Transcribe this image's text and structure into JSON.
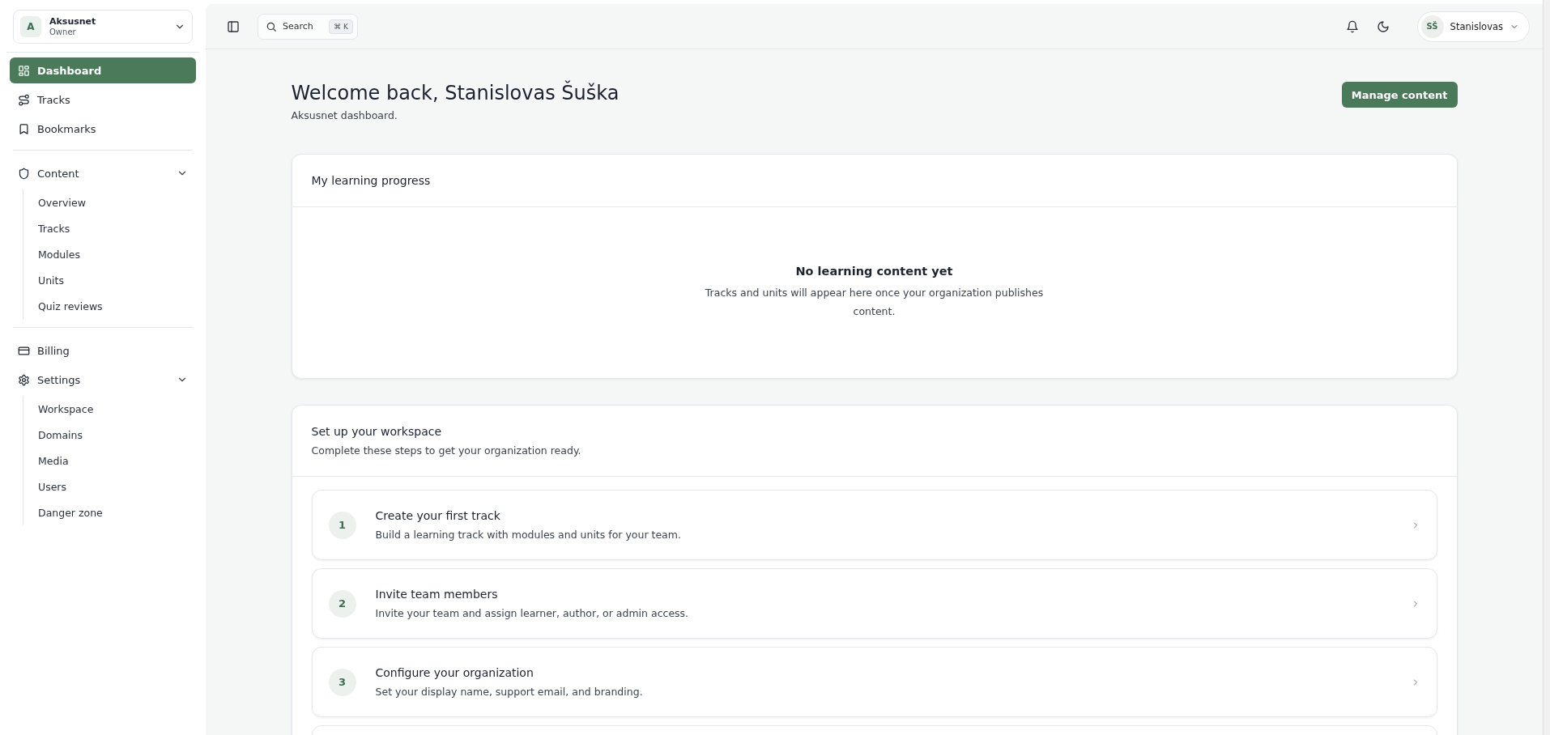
{
  "org": {
    "initial": "A",
    "name": "Aksusnet",
    "role": "Owner"
  },
  "sidebar": {
    "groups": [
      {
        "items": [
          {
            "label": "Dashboard",
            "selected": true
          },
          {
            "label": "Tracks",
            "selected": false
          },
          {
            "label": "Bookmarks",
            "selected": false
          }
        ]
      },
      {
        "items": [
          {
            "label": "Content",
            "selected": false,
            "expanded": true,
            "children": [
              {
                "label": "Overview",
                "selected": false
              },
              {
                "label": "Tracks",
                "selected": false
              },
              {
                "label": "Modules",
                "selected": false
              },
              {
                "label": "Units",
                "selected": false
              },
              {
                "label": "Quiz reviews",
                "selected": false
              }
            ]
          }
        ]
      },
      {
        "items": [
          {
            "label": "Billing",
            "selected": false
          },
          {
            "label": "Settings",
            "selected": false,
            "expanded": true,
            "children": [
              {
                "label": "Workspace",
                "selected": false
              },
              {
                "label": "Domains",
                "selected": false
              },
              {
                "label": "Media",
                "selected": false
              },
              {
                "label": "Users",
                "selected": false
              },
              {
                "label": "Danger zone",
                "selected": false
              }
            ]
          }
        ]
      }
    ]
  },
  "topbar": {
    "search": {
      "placeholder": "Search",
      "shortcut": "⌘ K"
    },
    "user": {
      "initials": "SŠ",
      "name": "Stanislovas"
    }
  },
  "header": {
    "title": "Welcome back, Stanislovas Šuška",
    "subtitle": "Aksusnet dashboard.",
    "action": "Manage content"
  },
  "progress": {
    "title": "My learning progress",
    "empty_title": "No learning content yet",
    "empty_text": "Tracks and units will appear here once your organization publishes content."
  },
  "setup": {
    "title": "Set up your workspace",
    "subtitle": "Complete these steps to get your organization ready.",
    "steps": [
      {
        "number": "1",
        "title": "Create your first track",
        "text": "Build a learning track with modules and units for your team."
      },
      {
        "number": "2",
        "title": "Invite team members",
        "text": "Invite your team and assign learner, author, or admin access."
      },
      {
        "number": "3",
        "title": "Configure your organization",
        "text": "Set your display name, support email, and branding."
      }
    ]
  }
}
